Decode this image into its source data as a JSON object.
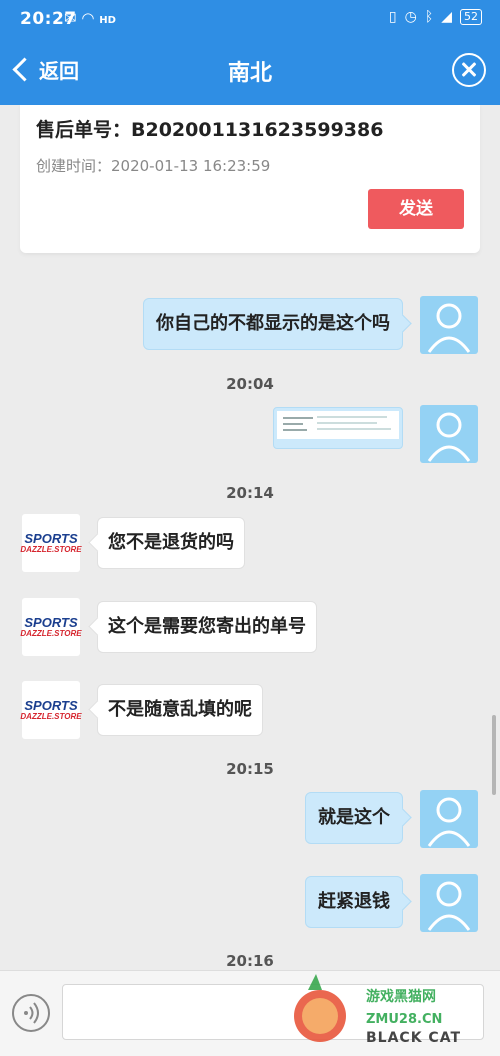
{
  "status_bar": {
    "time": "20:27",
    "network": "HD",
    "battery": "52"
  },
  "header": {
    "back_label": "返回",
    "title": "南北"
  },
  "order_card": {
    "order_number": "售后单号：B202001131623599386",
    "created_time": "创建时间：2020-01-13 16:23:59",
    "send_label": "发送"
  },
  "shop_logo": {
    "line1": "SPORTS",
    "line2": "DAZZLE.STORE"
  },
  "messages": [
    {
      "side": "right",
      "text": "你自己的不都显示的是这个吗"
    },
    {
      "type": "timestamp",
      "text": "20:04"
    },
    {
      "side": "right",
      "type": "image",
      "text": ""
    },
    {
      "type": "timestamp",
      "text": "20:14"
    },
    {
      "side": "left",
      "text": "您不是退货的吗"
    },
    {
      "side": "left",
      "text": "这个是需要您寄出的单号"
    },
    {
      "side": "left",
      "text": "不是随意乱填的呢"
    },
    {
      "type": "timestamp",
      "text": "20:15"
    },
    {
      "side": "right",
      "text": "就是这个"
    },
    {
      "side": "right",
      "text": "赶紧退钱"
    },
    {
      "type": "timestamp",
      "text": "20:16"
    }
  ],
  "input_bar": {
    "placeholder": ""
  },
  "watermark": {
    "line1": "游戏黑猫网",
    "line2": "ZMU28.CN",
    "line3": "BLACK CAT"
  },
  "colors": {
    "header_bg": "#2f8ee4",
    "send_button": "#ef5a5e",
    "own_bubble": "#cce9fb",
    "user_avatar": "#94d2f4"
  }
}
